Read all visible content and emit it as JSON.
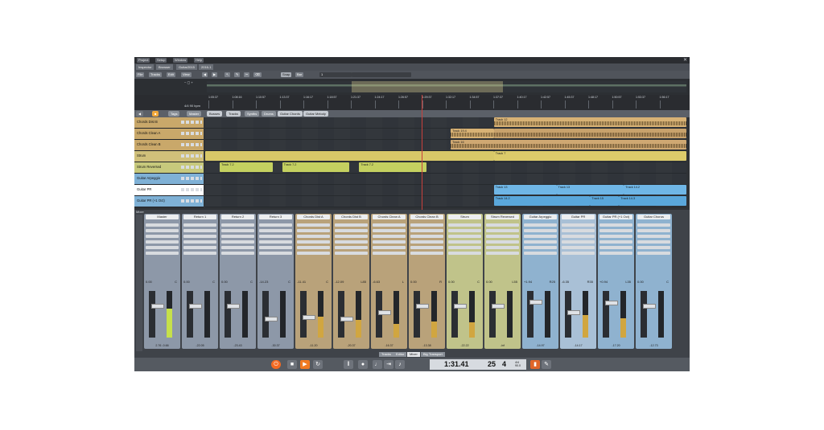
{
  "menu": [
    "Project",
    "Setup",
    "Window",
    "Help"
  ],
  "tabs": [
    "Inspector",
    "Browser",
    "Guitar2015",
    "2016-1"
  ],
  "toolbar": {
    "left": [
      "File",
      "Tracks",
      "Edit",
      "View"
    ],
    "snap_label": "Snap",
    "grid_label": "Bar",
    "grid_value": "1"
  },
  "ruler": {
    "time_sig": "4/4  90 bpm",
    "ticks": [
      "1:05:37",
      "1:08:16",
      "1:10:57",
      "1:13:37",
      "1:16:17",
      "1:18:57",
      "1:21:37",
      "1:24:17",
      "1:26:57",
      "1:29:37",
      "1:32:17",
      "1:34:57",
      "1:37:37",
      "1:40:17",
      "1:42:57",
      "1:45:37",
      "1:48:17",
      "1:50:57",
      "1:53:37",
      "1:56:17"
    ]
  },
  "filters": [
    "Tags",
    "Master",
    "Busses",
    "Tracks",
    "Synths",
    "Drums",
    "Guitar Chords",
    "Guitar Melody"
  ],
  "tracks": [
    {
      "name": "Chords Dist B",
      "color": "#c9a86a",
      "clips": [
        {
          "label": "Track 12",
          "start": 0.6,
          "end": 1.0,
          "color": "#d8b275",
          "wave": true
        }
      ]
    },
    {
      "name": "Chords Clean A",
      "color": "#c9a86a",
      "clips": [
        {
          "label": "Track 19.4",
          "start": 0.51,
          "end": 0.6,
          "color": "#d8b275",
          "wave": true
        },
        {
          "label": "",
          "start": 0.6,
          "end": 1.0,
          "color": "#c8a26c",
          "wave": true
        }
      ]
    },
    {
      "name": "Chords Clean B",
      "color": "#c9a86a",
      "clips": [
        {
          "label": "Track 16",
          "start": 0.51,
          "end": 1.0,
          "color": "#cfa872",
          "wave": true
        }
      ]
    },
    {
      "name": "Strum",
      "color": "#d0c07a",
      "clips": [
        {
          "label": "",
          "start": 0.0,
          "end": 0.6,
          "color": "#d8c868",
          "wave": false
        },
        {
          "label": "Track 7",
          "start": 0.6,
          "end": 1.0,
          "color": "#dccb6a",
          "wave": false
        }
      ]
    },
    {
      "name": "Strum Reversed",
      "color": "#c7c97c",
      "clips": [
        {
          "label": "Track 7.2",
          "start": 0.03,
          "end": 0.14,
          "color": "#c4d060",
          "wave": false
        },
        {
          "label": "Track 7.2",
          "start": 0.16,
          "end": 0.3,
          "color": "#c4d060",
          "wave": false
        },
        {
          "label": "Track 7.2",
          "start": 0.32,
          "end": 0.46,
          "color": "#c4d060",
          "wave": false
        }
      ]
    },
    {
      "name": "Guitar Arpeggio",
      "color": "#7fb1d6",
      "clips": []
    },
    {
      "name": "Guitar PR",
      "color": "#ffffff",
      "clips": [
        {
          "label": "Track 13",
          "start": 0.6,
          "end": 0.73,
          "color": "#6fb6e6",
          "wave": false
        },
        {
          "label": "Track 13",
          "start": 0.73,
          "end": 0.87,
          "color": "#6fb6e6",
          "wave": false
        },
        {
          "label": "Track 14.2",
          "start": 0.87,
          "end": 1.0,
          "color": "#6fb6e6",
          "wave": false
        }
      ]
    },
    {
      "name": "Guitar PR (+1 Oct)",
      "color": "#7fb1d6",
      "clips": [
        {
          "label": "Track 14.2",
          "start": 0.6,
          "end": 0.8,
          "color": "#5aa7db",
          "wave": false
        },
        {
          "label": "Track 15",
          "start": 0.8,
          "end": 0.86,
          "color": "#5aa7db",
          "wave": false
        },
        {
          "label": "Track 14.3",
          "start": 0.86,
          "end": 1.0,
          "color": "#5aa7db",
          "wave": false
        }
      ]
    }
  ],
  "mixer": {
    "header": "Mixer",
    "strips": [
      {
        "name": "Master",
        "color": "#8d98a8",
        "vol": "0.00",
        "pan": "C",
        "level": 0.62,
        "fader": 0.3,
        "footer": "2.76   -0.66"
      },
      {
        "name": "Return 1",
        "color": "#8d98a8",
        "vol": "0.00",
        "pan": "C",
        "level": 0,
        "fader": 0.3,
        "footer": "-22.05"
      },
      {
        "name": "Return 2",
        "color": "#8d98a8",
        "vol": "0.00",
        "pan": "C",
        "level": 0,
        "fader": 0.3,
        "footer": "-23.43"
      },
      {
        "name": "Return 3",
        "color": "#8d98a8",
        "vol": "-14.23",
        "pan": "C",
        "level": 0,
        "fader": 0.6,
        "footer": "-30.37"
      },
      {
        "name": "Chords Dist A",
        "color": "#b9a27a",
        "vol": "-11.41",
        "pan": "C",
        "level": 0.45,
        "fader": 0.55,
        "footer": "-11.20"
      },
      {
        "name": "Chords Dist B",
        "color": "#b9a27a",
        "vol": "-12.09",
        "pan": "L85",
        "level": 0.38,
        "fader": 0.6,
        "footer": "-20.37"
      },
      {
        "name": "Chords Clean A",
        "color": "#b9a27a",
        "vol": "-6.63",
        "pan": "L",
        "level": 0.3,
        "fader": 0.45,
        "footer": "-16.37"
      },
      {
        "name": "Chords Clean B",
        "color": "#b9a27a",
        "vol": "0.00",
        "pan": "R",
        "level": 0.35,
        "fader": 0.3,
        "footer": "-13.38"
      },
      {
        "name": "Strum",
        "color": "#c0c38a",
        "vol": "0.00",
        "pan": "C",
        "level": 0.32,
        "fader": 0.3,
        "footer": "-22.22"
      },
      {
        "name": "Strum Reversed",
        "color": "#c0c38a",
        "vol": "0.00",
        "pan": "L55",
        "level": 0,
        "fader": 0.3,
        "footer": "-inf"
      },
      {
        "name": "Guitar Arpeggio",
        "color": "#8fb2cf",
        "vol": "+1.94",
        "pan": "R25",
        "level": 0,
        "fader": 0.2,
        "footer": "-14.97"
      },
      {
        "name": "Guitar PR",
        "color": "#a9c0d6",
        "vol": "-6.35",
        "pan": "R35",
        "level": 0.48,
        "fader": 0.45,
        "footer": "-14.17"
      },
      {
        "name": "Guitar PR (+1 Oct)",
        "color": "#8fb2cf",
        "vol": "+0.94",
        "pan": "L35",
        "level": 0.42,
        "fader": 0.22,
        "footer": "-17.20"
      },
      {
        "name": "Guitar Chorus",
        "color": "#8fb2cf",
        "vol": "0.00",
        "pan": "C",
        "level": 0,
        "fader": 0.3,
        "footer": "-12.73"
      }
    ]
  },
  "view_tabs": [
    "Tracks",
    "Editor",
    "Mixer",
    "Big Transport"
  ],
  "transport": {
    "time": "1:31.41",
    "bar": "25",
    "beat": "4",
    "sig": "4/4\n90.0"
  }
}
